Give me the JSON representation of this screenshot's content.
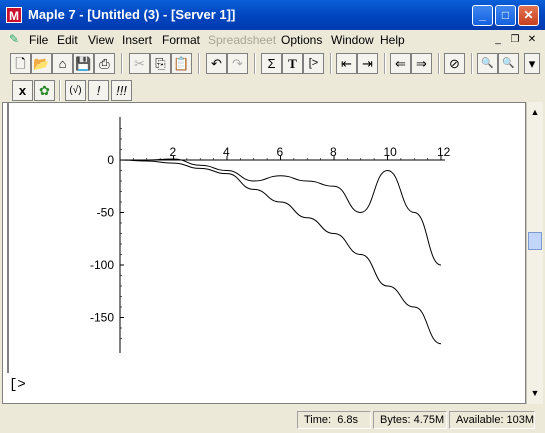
{
  "window": {
    "title": "Maple 7  - [Untitled (3) - [Server 1]]"
  },
  "menubar": {
    "items": [
      "File",
      "Edit",
      "View",
      "Insert",
      "Format",
      "Spreadsheet",
      "Options",
      "Window",
      "Help"
    ],
    "disabled": [
      "Spreadsheet"
    ]
  },
  "toolbar": {
    "sigma_label": "Σ",
    "text_label": "T",
    "prompt_label": "[>"
  },
  "context_toolbar": {
    "x_label": "x",
    "check_label": "(√)",
    "exclaim_label": "!",
    "triple_exclaim_label": "!!!"
  },
  "chart_data": {
    "type": "line",
    "x_ticks": [
      2,
      4,
      6,
      8,
      10,
      12
    ],
    "y_ticks": [
      0,
      -50,
      -100,
      -150
    ],
    "xlim": [
      0,
      12
    ],
    "ylim": [
      -180,
      40
    ],
    "series": [
      {
        "x": [
          0,
          1,
          2,
          3,
          4,
          5,
          6,
          7,
          8,
          9,
          10,
          11,
          12
        ],
        "y": [
          0,
          -1,
          -3,
          -8,
          -13,
          -28,
          -40,
          -55,
          -70,
          -90,
          -120,
          -140,
          -175
        ]
      },
      {
        "x": [
          0,
          1,
          2,
          3,
          4,
          5,
          6,
          7,
          8,
          9,
          10,
          11,
          12
        ],
        "y": [
          0,
          0,
          1,
          -5,
          -10,
          -20,
          -15,
          -20,
          -25,
          -50,
          -10,
          -50,
          -100
        ]
      }
    ]
  },
  "worksheet": {
    "prompt": "[>"
  },
  "statusbar": {
    "time": "Time:  6.8s",
    "bytes": "Bytes: 4.75M",
    "available": "Available: 103M"
  }
}
